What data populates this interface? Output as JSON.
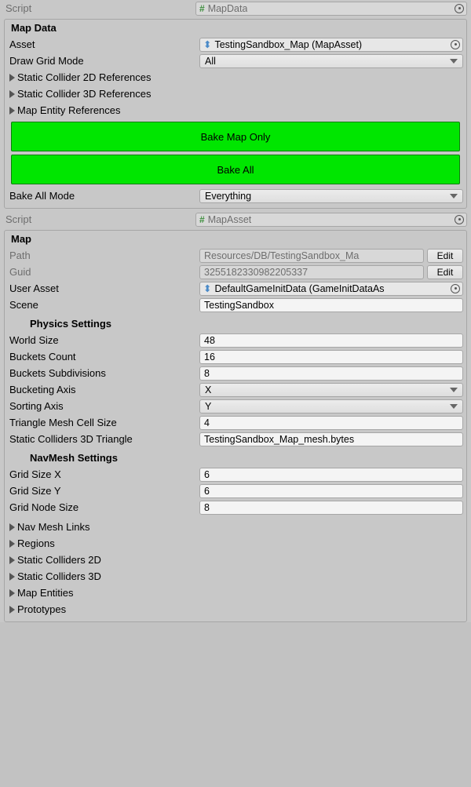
{
  "colors": {
    "accent_green": "#00e600"
  },
  "script_row1": {
    "label": "Script",
    "value": "MapData",
    "icon": "cs-script-icon"
  },
  "section_mapdata": {
    "heading": "Map Data",
    "asset": {
      "label": "Asset",
      "value": "TestingSandbox_Map (MapAsset)",
      "icon": "prefab-icon"
    },
    "draw_grid_mode": {
      "label": "Draw Grid Mode",
      "value": "All"
    },
    "foldouts": [
      "Static Collider 2D References",
      "Static Collider 3D References",
      "Map Entity References"
    ],
    "buttons": [
      "Bake Map Only",
      "Bake All"
    ],
    "bake_all_mode": {
      "label": "Bake All Mode",
      "value": "Everything"
    }
  },
  "script_row2": {
    "label": "Script",
    "value": "MapAsset",
    "icon": "cs-script-icon"
  },
  "section_map": {
    "heading": "Map",
    "path": {
      "label": "Path",
      "value": "Resources/DB/TestingSandbox_Ma",
      "edit": "Edit"
    },
    "guid": {
      "label": "Guid",
      "value": "3255182330982205337",
      "edit": "Edit"
    },
    "user_asset": {
      "label": "User Asset",
      "value": "DefaultGameInitData (GameInitDataAs",
      "icon": "prefab-icon"
    },
    "scene": {
      "label": "Scene",
      "value": "TestingSandbox"
    },
    "physics_heading": "Physics Settings",
    "physics": {
      "world_size": {
        "label": "World Size",
        "value": "48"
      },
      "buckets_count": {
        "label": "Buckets Count",
        "value": "16"
      },
      "buckets_subdiv": {
        "label": "Buckets Subdivisions",
        "value": "8"
      },
      "bucketing_axis": {
        "label": "Bucketing Axis",
        "value": "X"
      },
      "sorting_axis": {
        "label": "Sorting Axis",
        "value": "Y"
      },
      "tri_cell": {
        "label": "Triangle Mesh Cell Size",
        "value": "4"
      },
      "static_tri": {
        "label": "Static Colliders 3D Triangle",
        "value": "TestingSandbox_Map_mesh.bytes"
      }
    },
    "navmesh_heading": "NavMesh Settings",
    "navmesh": {
      "grid_x": {
        "label": "Grid Size X",
        "value": "6"
      },
      "grid_y": {
        "label": "Grid Size Y",
        "value": "6"
      },
      "node_sz": {
        "label": "Grid Node Size",
        "value": "8"
      }
    },
    "foldouts_bottom": [
      "Nav Mesh Links",
      "Regions",
      "Static Colliders 2D",
      "Static Colliders 3D",
      "Map Entities",
      "Prototypes"
    ]
  }
}
